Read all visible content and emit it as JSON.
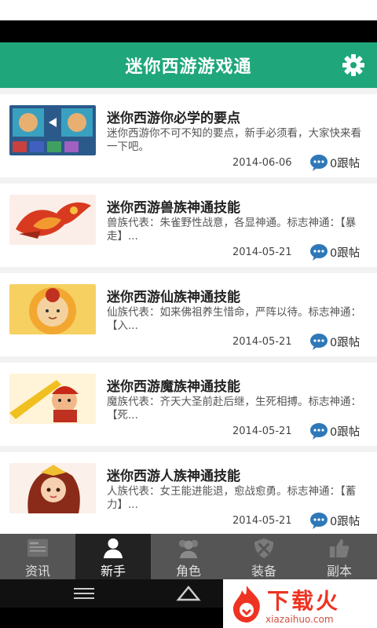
{
  "app": {
    "title": "迷你西游游戏通"
  },
  "colors": {
    "header": "#1fa67a",
    "tabbar": "#555555",
    "tab_active": "#222222",
    "reply_icon": "#2e78b8",
    "watermark": "#ee3322"
  },
  "articles": [
    {
      "title": "迷你西游你必学的要点",
      "desc": "迷你西游你不可不知的要点，新手必须看，大家快来看一下吧。",
      "date": "2014-06-06",
      "replies": "0跟帖"
    },
    {
      "title": "迷你西游兽族神通技能",
      "desc": "兽族代表：朱雀野性战意，各显神通。标志神通：【暴走】...",
      "date": "2014-05-21",
      "replies": "0跟帖"
    },
    {
      "title": "迷你西游仙族神通技能",
      "desc": "仙族代表：如来佛祖养生惜命，严阵以待。标志神通：【入...",
      "date": "2014-05-21",
      "replies": "0跟帖"
    },
    {
      "title": "迷你西游魔族神通技能",
      "desc": "魔族代表：齐天大圣前赴后继，生死相搏。标志神通：【死...",
      "date": "2014-05-21",
      "replies": "0跟帖"
    },
    {
      "title": "迷你西游人族神通技能",
      "desc": "人族代表：女王能进能退，愈战愈勇。标志神通：【蓄力】...",
      "date": "2014-05-21",
      "replies": "0跟帖"
    }
  ],
  "tabs": [
    {
      "label": "资讯",
      "icon": "news-icon"
    },
    {
      "label": "新手",
      "icon": "person-icon",
      "active": true
    },
    {
      "label": "角色",
      "icon": "group-icon"
    },
    {
      "label": "装备",
      "icon": "shield-icon"
    },
    {
      "label": "副本",
      "icon": "thumbs-up-icon"
    }
  ],
  "watermark": {
    "name": "下载火",
    "url": "xiazaihuo.com"
  }
}
